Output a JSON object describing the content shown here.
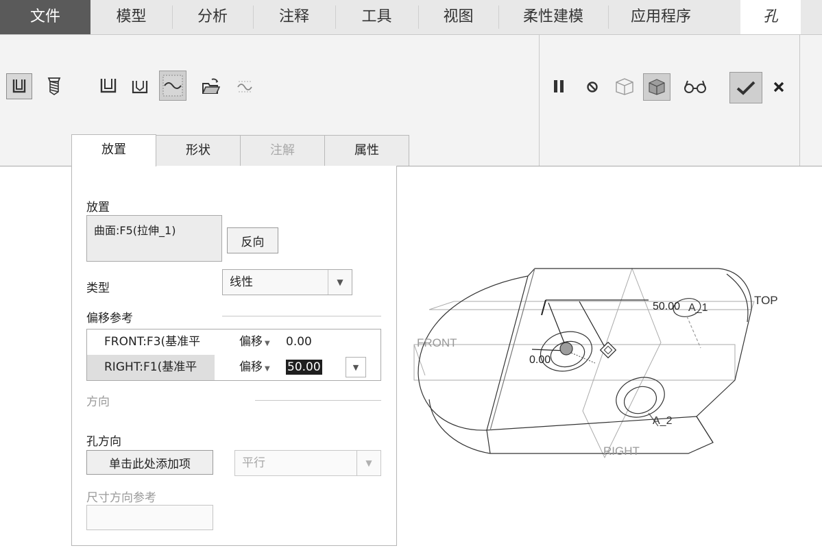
{
  "menubar": {
    "tabs": [
      "文件",
      "模型",
      "分析",
      "注释",
      "工具",
      "视图",
      "柔性建模",
      "应用程序"
    ],
    "active_tab": "孔"
  },
  "ribbon": {
    "icons": {
      "hole_straight": "hole-straight-icon",
      "hole_standard": "hole-standard-icon",
      "simple_profile": "simple-profile-icon",
      "standard_profile": "standard-profile-icon",
      "sketch_profile": "sketch-profile-icon",
      "open_sketch": "open-folder-icon",
      "activate_sketch": "sketcher-icon",
      "pause": "pause-icon",
      "no_preview": "no-preview-icon",
      "preview_geometry": "preview-geometry-icon",
      "verify_mode": "verify-mode-icon",
      "glasses": "glasses-icon",
      "ok": "check-icon",
      "cancel": "cancel-icon"
    }
  },
  "dashboard_tabs": {
    "placement": "放置",
    "shape": "形状",
    "note": "注解",
    "properties": "属性"
  },
  "panel": {
    "placement_label": "放置",
    "placement_ref": "曲面:F5(拉伸_1)",
    "flip_button": "反向",
    "type_label": "类型",
    "type_value": "线性",
    "offset_refs_label": "偏移参考",
    "offset_refs": [
      {
        "name": "FRONT:F3(基准平",
        "type": "偏移",
        "value": "0.00"
      },
      {
        "name": "RIGHT:F1(基准平",
        "type": "偏移",
        "value": "50.00"
      }
    ],
    "direction_label": "方向",
    "hole_direction_label": "孔方向",
    "add_item_button": "单击此处添加项",
    "direction_type": "平行",
    "dim_ref_label": "尺寸方向参考"
  },
  "viewport": {
    "labels": {
      "top": "TOP",
      "front": "FRONT",
      "right": "RIGHT",
      "a1": "A_1",
      "a2": "A_2",
      "dim_offset_right": "50.00",
      "dim_offset_front": "0.00"
    }
  }
}
